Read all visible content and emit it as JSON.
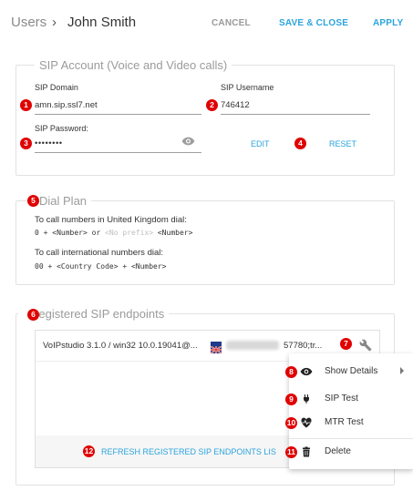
{
  "header": {
    "breadcrumb_root": "Users",
    "breadcrumb_sep": "›",
    "title": "John Smith",
    "cancel": "CANCEL",
    "save_close": "SAVE & CLOSE",
    "apply": "APPLY"
  },
  "sip_account": {
    "legend": "SIP Account (Voice and Video calls)",
    "domain_label": "SIP Domain",
    "domain_value": "amn.sip.ssl7.net",
    "username_label": "SIP Username",
    "username_value": "746412",
    "password_label": "SIP Password:",
    "password_value": "••••••••",
    "edit": "EDIT",
    "reset": "RESET"
  },
  "dial_plan": {
    "legend": "Dial Plan",
    "uk_text": "To call numbers in United Kingdom dial:",
    "uk_code_a": "0 + <Number> or ",
    "uk_code_muted": "<No prefix>",
    "uk_code_b": " <Number>",
    "intl_text": "To call international numbers dial:",
    "intl_code": "00 + <Country Code> + <Number>"
  },
  "registered": {
    "legend": "Registered SIP endpoints",
    "endpoint_text": "VoIPstudio 3.1.0 / win32 10.0.19041@...",
    "endpoint_tail": "57780;tr...",
    "refresh": "REFRESH REGISTERED SIP ENDPOINTS LIS"
  },
  "context_menu": {
    "items": [
      {
        "label": "Show Details",
        "icon": "eye-icon"
      },
      {
        "label": "SIP Test",
        "icon": "plug-icon"
      },
      {
        "label": "MTR Test",
        "icon": "heartbeat-icon"
      },
      {
        "label": "Delete",
        "icon": "trash-icon"
      }
    ]
  },
  "badges": [
    "1",
    "2",
    "3",
    "4",
    "5",
    "6",
    "7",
    "8",
    "9",
    "10",
    "11",
    "12"
  ],
  "colors": {
    "accent": "#2ba4dd",
    "badge": "#e00000"
  }
}
